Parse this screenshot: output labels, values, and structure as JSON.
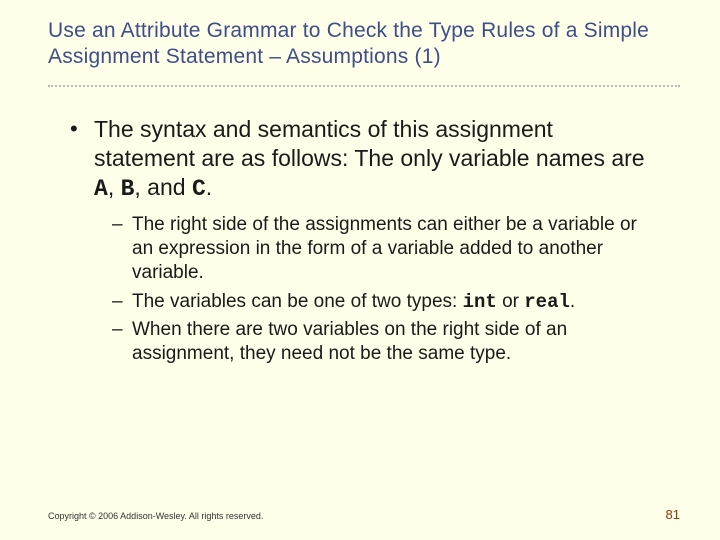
{
  "title": "Use an Attribute Grammar to Check the Type Rules of a Simple Assignment Statement – Assumptions (1)",
  "bullet": {
    "pre": "The syntax and semantics of this assignment statement are as follows: The only variable names are ",
    "varA": "A",
    "sep1": ", ",
    "varB": "B",
    "sep2": ", and ",
    "varC": "C",
    "post": "."
  },
  "sub": {
    "s1": "The right side of the assignments can either be a variable or an expression in the form of a variable added to another variable.",
    "s2_pre": "The variables can be one of two types: ",
    "s2_int": "int",
    "s2_mid": " or ",
    "s2_real": "real",
    "s2_post": ".",
    "s3": "When there are two variables on the right side of an assignment, they need not be the same type."
  },
  "footer": {
    "copyright": "Copyright © 2006 Addison-Wesley. All rights reserved.",
    "page": "81"
  }
}
